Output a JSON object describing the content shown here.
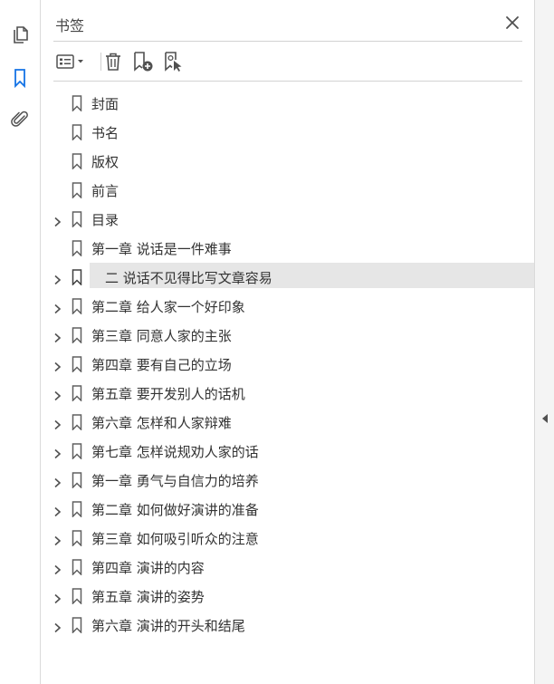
{
  "panel": {
    "title": "书签"
  },
  "toolbar": {
    "buttons": [
      "options-menu",
      "delete-bookmark",
      "new-bookmark",
      "new-bookmark-from-structure"
    ]
  },
  "left_rail": {
    "items": [
      {
        "icon": "page-thumbnails-icon",
        "active": false
      },
      {
        "icon": "bookmark-icon",
        "active": true
      },
      {
        "icon": "attachment-icon",
        "active": false
      }
    ]
  },
  "bookmarks": [
    {
      "label": "封面",
      "expandable": false,
      "selected": false
    },
    {
      "label": "书名",
      "expandable": false,
      "selected": false
    },
    {
      "label": "版权",
      "expandable": false,
      "selected": false
    },
    {
      "label": "前言",
      "expandable": false,
      "selected": false
    },
    {
      "label": "目录",
      "expandable": true,
      "selected": false
    },
    {
      "label": "第一章 说话是一件难事",
      "expandable": false,
      "selected": false
    },
    {
      "label": "　二 说话不见得比写文章容易",
      "expandable": true,
      "selected": true
    },
    {
      "label": "第二章 给人家一个好印象",
      "expandable": true,
      "selected": false
    },
    {
      "label": "第三章 同意人家的主张",
      "expandable": true,
      "selected": false
    },
    {
      "label": "第四章 要有自己的立场",
      "expandable": true,
      "selected": false
    },
    {
      "label": "第五章 要开发别人的话机",
      "expandable": true,
      "selected": false
    },
    {
      "label": "第六章 怎样和人家辩难",
      "expandable": true,
      "selected": false
    },
    {
      "label": "第七章 怎样说规劝人家的话",
      "expandable": true,
      "selected": false
    },
    {
      "label": "第一章 勇气与自信力的培养",
      "expandable": true,
      "selected": false
    },
    {
      "label": "第二章 如何做好演讲的准备",
      "expandable": true,
      "selected": false
    },
    {
      "label": "第三章 如何吸引听众的注意",
      "expandable": true,
      "selected": false
    },
    {
      "label": "第四章 演讲的内容",
      "expandable": true,
      "selected": false
    },
    {
      "label": "第五章 演讲的姿势",
      "expandable": true,
      "selected": false
    },
    {
      "label": "第六章 演讲的开头和结尾",
      "expandable": true,
      "selected": false
    }
  ],
  "colors": {
    "accent": "#1473e6",
    "icon": "#505050",
    "selected_row": "#e6e6e6"
  }
}
